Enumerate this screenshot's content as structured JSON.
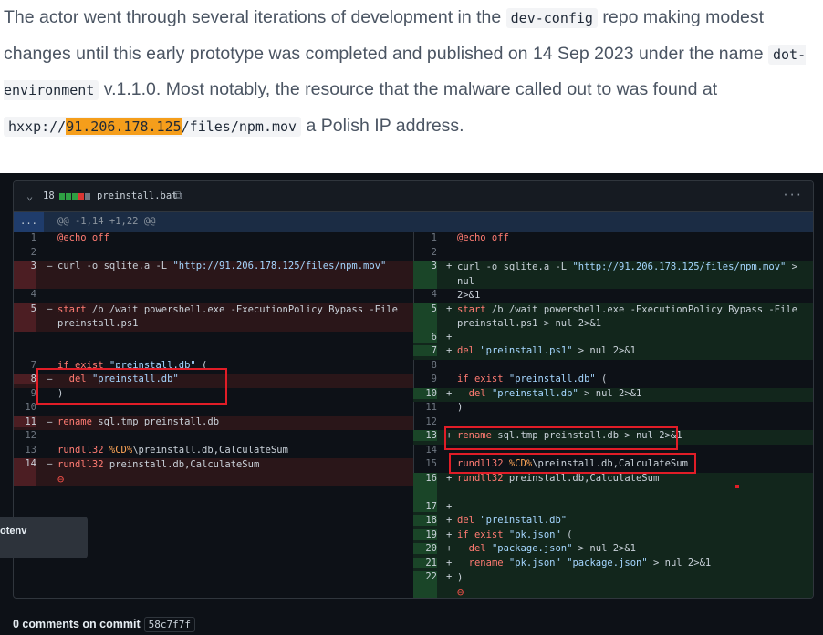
{
  "article": {
    "p1_a": "The actor went through several iterations of development in the ",
    "p1_code": "dev-config",
    "p1_b": " repo making modest changes until this early prototype was completed and published on 14 Sep 2023 under the name ",
    "p1_code2": "dot-environment",
    "p1_c": " v.1.1.0. Most notably, the resource that the malware called out to was found at ",
    "url_prefix": "hxxp://",
    "url_ip": "91.206.178.125",
    "url_suffix": "/files/npm.mov",
    "p1_d": " a Polish IP address."
  },
  "file_header": {
    "chevron": "chevron-down-icon",
    "changes": "18",
    "bar_colors": [
      "#2ea043",
      "#2ea043",
      "#2ea043",
      "#da3633",
      "#6e7681"
    ],
    "filename": "preinstall.bat",
    "copy_icon": "⧉",
    "more_icon": "···"
  },
  "hunk": {
    "dots": "...",
    "header": "@@ -1,14 +1,22 @@"
  },
  "tooltip": {
    "text": "otenv"
  },
  "comments": {
    "label": "0 comments on commit",
    "sha": "58c7f7f"
  },
  "colors": {
    "highlight": "#f59e1b",
    "annotation_box": "#e11d27"
  }
}
